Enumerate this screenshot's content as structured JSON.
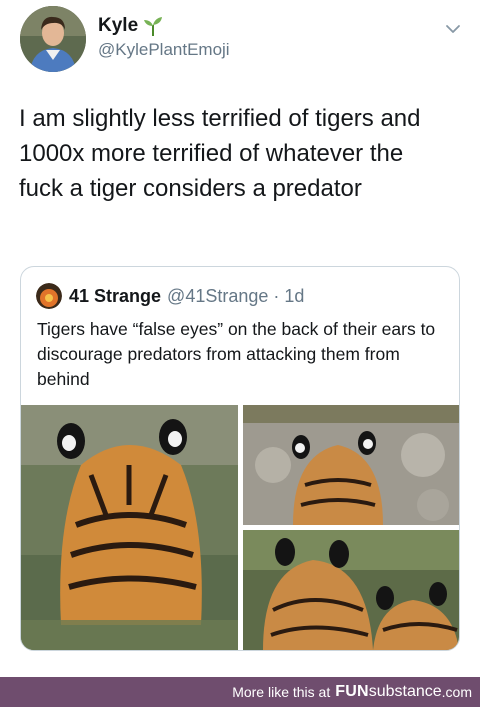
{
  "tweet": {
    "display_name": "Kyle",
    "name_emoji_icon": "seedling-icon",
    "handle": "@KylePlantEmoji",
    "text": "I am slightly less terrified of tigers and\n1000x more terrified of whatever the\nfuck a tiger considers a predator"
  },
  "quote": {
    "display_name": "41 Strange",
    "handle": "@41Strange · 1d",
    "text": "Tigers have “false eyes” on the back of their ears to discourage predators from attacking them from behind",
    "images": [
      "tiger-back-in-water",
      "tiger-back-on-rocks",
      "two-tigers-ears"
    ]
  },
  "footer": {
    "lead": "More like this at",
    "brand_bold": "FUN",
    "brand_light": "substance",
    "tld": ".com",
    "background": "#6f4d6e"
  },
  "colors": {
    "text": "#14171a",
    "secondary": "#657786",
    "border": "#ccd6dd"
  }
}
